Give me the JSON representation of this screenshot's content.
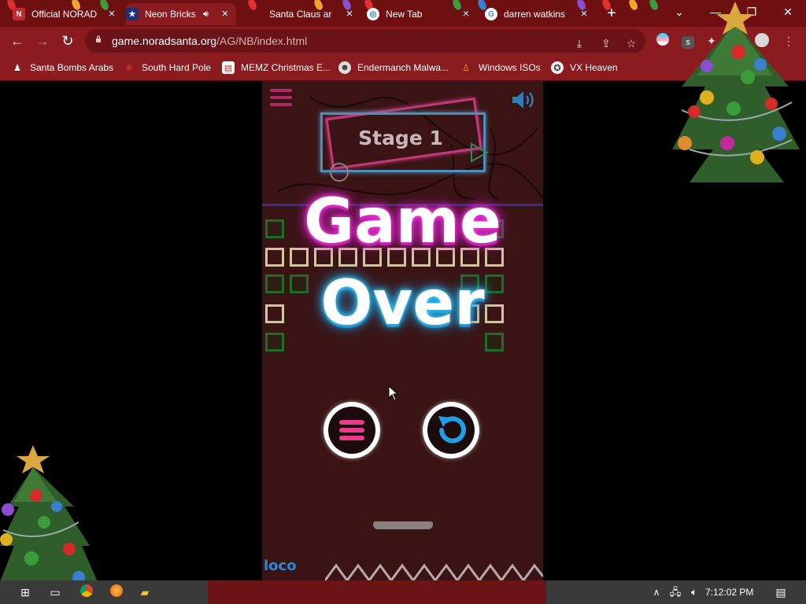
{
  "tabs": [
    {
      "title": "Official NORAD",
      "close": "×"
    },
    {
      "title": "Neon Bricks",
      "close": "×"
    },
    {
      "title": "Santa Claus ar",
      "close": "×"
    },
    {
      "title": "New Tab",
      "close": "×"
    },
    {
      "title": "darren watkins",
      "close": "×"
    }
  ],
  "window": {
    "new_tab": "+",
    "dropdown": "⌄",
    "minimize": "—",
    "restore": "❐",
    "close": "✕"
  },
  "address_bar": {
    "domain": "game.noradsanta.org",
    "path": "/AG/NB/index.html"
  },
  "bookmarks": [
    {
      "label": "Santa Bombs Arabs"
    },
    {
      "label": "South Hard Pole"
    },
    {
      "label": "MEMZ Christmas E..."
    },
    {
      "label": "Endermanch Malwa..."
    },
    {
      "label": "Windows ISOs"
    },
    {
      "label": "VX Heaven"
    }
  ],
  "game": {
    "stage_label": "Stage 1",
    "title_line1": "Game",
    "title_line2": "Over",
    "logo_text": "loco"
  },
  "taskbar": {
    "clock": "7:12:02 PM"
  },
  "colors": {
    "tab_strip": "#6e0f12",
    "toolbar": "#8a1b1f",
    "game_bg": "#3a1414",
    "neon_pink": "#ff3fe0",
    "neon_blue": "#3fd5ff",
    "menu_pink": "#e83a8e",
    "replay_blue": "#1ea0e8"
  },
  "icons": [
    "menu-icon",
    "sound-icon",
    "replay-icon",
    "lock-icon",
    "star-icon",
    "download-icon",
    "share-icon",
    "extension-icon",
    "profile-icon"
  ]
}
